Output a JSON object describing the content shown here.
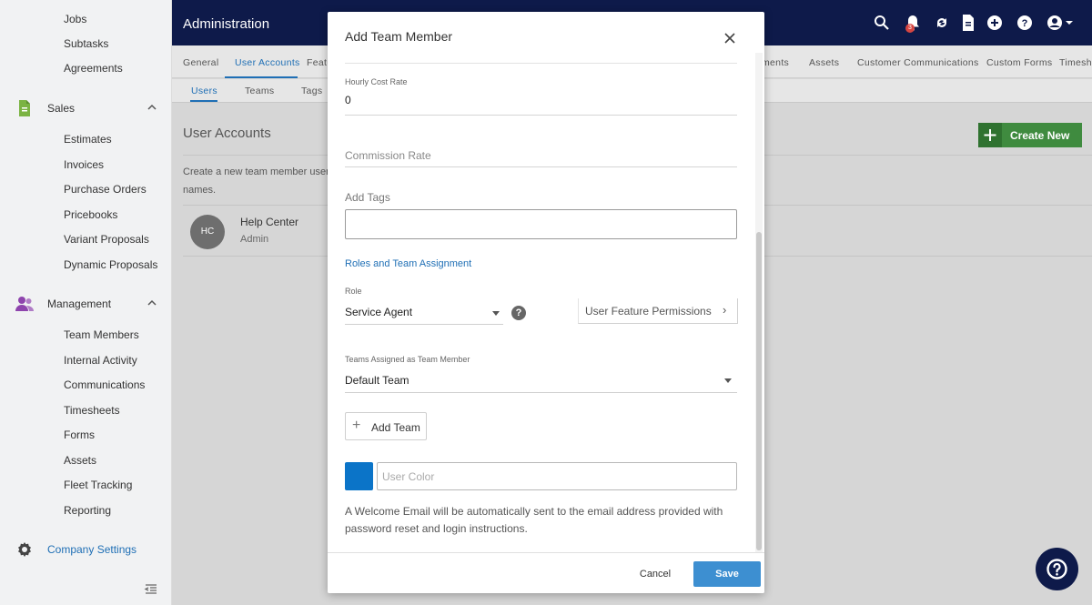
{
  "sidebar": {
    "top_items": [
      "Jobs",
      "Subtasks",
      "Agreements"
    ],
    "sales": {
      "label": "Sales",
      "icon": "document-green-icon",
      "items": [
        "Estimates",
        "Invoices",
        "Purchase Orders",
        "Pricebooks",
        "Variant Proposals",
        "Dynamic Proposals"
      ]
    },
    "management": {
      "label": "Management",
      "icon": "people-icon",
      "items": [
        "Team Members",
        "Internal Activity",
        "Communications",
        "Timesheets",
        "Forms",
        "Assets",
        "Fleet Tracking",
        "Reporting"
      ]
    },
    "company_settings": "Company Settings"
  },
  "topbar": {
    "title": "Administration",
    "notification_count": "3",
    "icons": [
      "search-icon",
      "bell-icon",
      "sync-icon",
      "document-icon",
      "add-circle-icon",
      "help-icon",
      "account-icon"
    ]
  },
  "tabs_primary": [
    "General",
    "User Accounts",
    "Featu",
    "ments",
    "Assets",
    "Customer Communications",
    "Custom Forms",
    "Timesh"
  ],
  "tabs_secondary": [
    "Users",
    "Teams",
    "Tags"
  ],
  "page": {
    "title": "User Accounts",
    "description_line1": "Create a new team member user a",
    "description_line2": "names.",
    "create_button": "Create New",
    "user": {
      "initials": "HC",
      "name": "Help Center",
      "role": "Admin"
    }
  },
  "modal": {
    "title": "Add Team Member",
    "hourly_cost_rate_label": "Hourly Cost Rate",
    "hourly_cost_rate_value": "0",
    "commission_rate_placeholder": "Commission Rate",
    "add_tags_label": "Add Tags",
    "section_link": "Roles and Team Assignment",
    "role_label": "Role",
    "role_value": "Service Agent",
    "help_glyph": "?",
    "user_feature_permissions": "User Feature Permissions",
    "teams_label": "Teams Assigned as Team Member",
    "teams_value": "Default Team",
    "add_team_button": "Add Team",
    "user_color_placeholder": "User Color",
    "user_color_swatch": "#0b74c8",
    "welcome_text": "A Welcome Email will be automatically sent to the email address provided with password reset and login instructions.",
    "cancel_button": "Cancel",
    "save_button": "Save"
  },
  "colors": {
    "topbar": "#0e1a4a",
    "accent": "#1f6fb5",
    "create_button": "#3f8b3f",
    "save_button": "#3d8fd1"
  }
}
